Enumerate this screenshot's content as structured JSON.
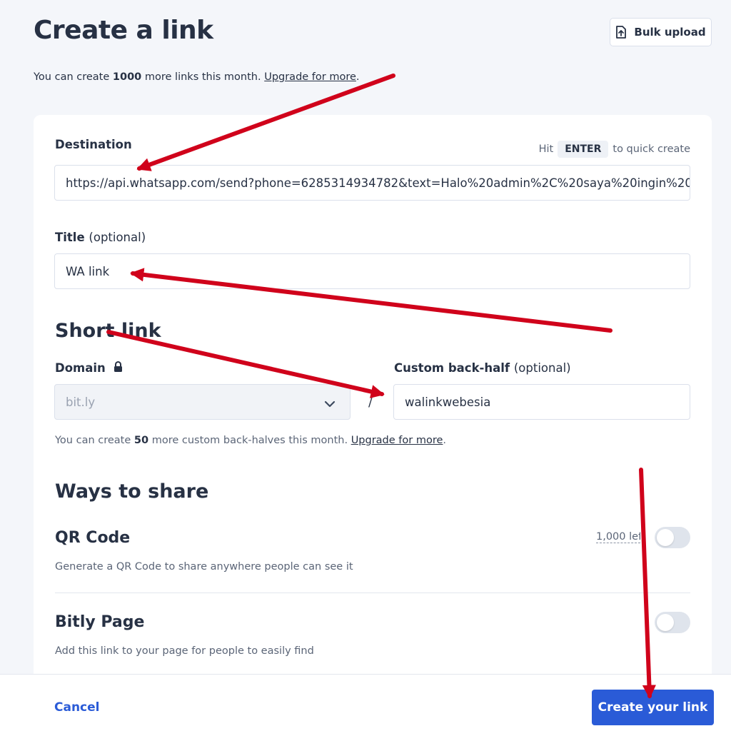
{
  "header": {
    "title": "Create a link",
    "bulk_upload_label": "Bulk upload"
  },
  "quota": {
    "prefix": "You can create ",
    "count": "1000",
    "suffix": " more links this month. ",
    "upgrade_label": "Upgrade for more",
    "end": "."
  },
  "destination": {
    "label": "Destination",
    "hint_prefix": "Hit",
    "hint_key": "ENTER",
    "hint_suffix": "to quick create",
    "value": "https://api.whatsapp.com/send?phone=6285314934782&text=Halo%20admin%2C%20saya%20ingin%20"
  },
  "title_field": {
    "label": "Title",
    "optional": "(optional)",
    "value": "WA link"
  },
  "short_link": {
    "heading": "Short link",
    "domain_label": "Domain",
    "domain_value": "bit.ly",
    "separator": "/",
    "back_half_label": "Custom back-half",
    "back_half_optional": "(optional)",
    "back_half_value": "walinkwebesia",
    "note_prefix": "You can create ",
    "note_count": "50",
    "note_suffix": " more custom back-halves this month. ",
    "upgrade_label": "Upgrade for more",
    "note_end": "."
  },
  "share": {
    "heading": "Ways to share",
    "qr_title": "QR Code",
    "qr_desc": "Generate a QR Code to share anywhere people can see it",
    "qr_left": "1,000 left",
    "page_title": "Bitly Page",
    "page_desc": "Add this link to your page for people to easily find"
  },
  "footer": {
    "cancel_label": "Cancel",
    "create_label": "Create your link"
  },
  "colors": {
    "primary": "#2a5bd7",
    "annotation_arrow": "#d0021b"
  }
}
